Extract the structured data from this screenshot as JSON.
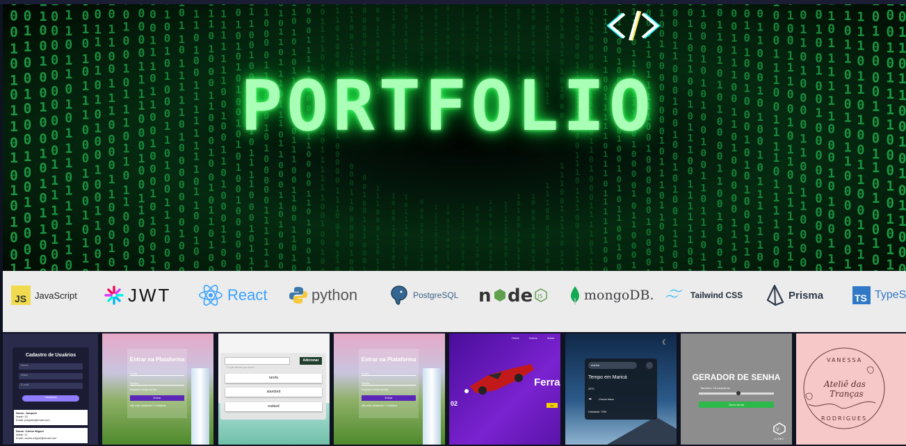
{
  "hero": {
    "title": "PORTFOLIO",
    "code_icon": "code-brackets-icon"
  },
  "tech_stack": [
    {
      "name": "JavaScript",
      "icon": "javascript-icon"
    },
    {
      "name": "JWT",
      "icon": "jwt-icon"
    },
    {
      "name": "React",
      "icon": "react-icon"
    },
    {
      "name": "python",
      "icon": "python-icon"
    },
    {
      "name": "PostgreSQL",
      "icon": "postgresql-icon"
    },
    {
      "name": "node",
      "icon": "nodejs-icon"
    },
    {
      "name": "mongoDB.",
      "icon": "mongodb-icon"
    },
    {
      "name": "Tailwind CSS",
      "icon": "tailwind-icon"
    },
    {
      "name": "Prisma",
      "icon": "prisma-icon"
    },
    {
      "name": "TypeScr",
      "icon": "typescript-icon"
    }
  ],
  "projects": {
    "users": {
      "title": "Cadastro de Usuários",
      "fields": [
        "Nome",
        "Idade",
        "E-mail"
      ],
      "button": "Cadastrar",
      "entries": [
        {
          "name": "Nome: Joaquim",
          "age": "Idade: 33",
          "email": "Email: joaquim@email.com"
        },
        {
          "name": "Nome: Carlos Miguel",
          "age": "Idade: 11",
          "email": "Email: carlos-miguel@email.com"
        }
      ]
    },
    "login": {
      "title": "Entrar na Plataforma",
      "email": "Email",
      "password": "Senha",
      "forgot": "Esqueci minha senha",
      "button": "Entrar",
      "signup": "Não está cadastrado ? Cadastrar"
    },
    "todo": {
      "placeholder": "O que tenho que fazer...",
      "button": "Adicionar",
      "items": [
        "tarefa",
        "atandard",
        "eadasd"
      ]
    },
    "ferrari": {
      "brand": "Ferrari",
      "number": "02",
      "nav": [
        "Home",
        "Carros",
        "Sobre"
      ],
      "cta": "Ver"
    },
    "weather": {
      "city": "marica",
      "title": "Tempo em Maricá",
      "temp": "29°C",
      "desc": "Chuva fraca",
      "humidity": "Umidade: 70%"
    },
    "password": {
      "title": "GERADOR DE SENHA",
      "size_label": "Tamanho: 15 caracteres",
      "button": "Gerar senha",
      "brand": "JV DEV"
    },
    "atelie": {
      "top": "VANESSA",
      "script1": "Ateliê das",
      "script2": "Tranças",
      "bottom": "RODRIGUES"
    }
  }
}
